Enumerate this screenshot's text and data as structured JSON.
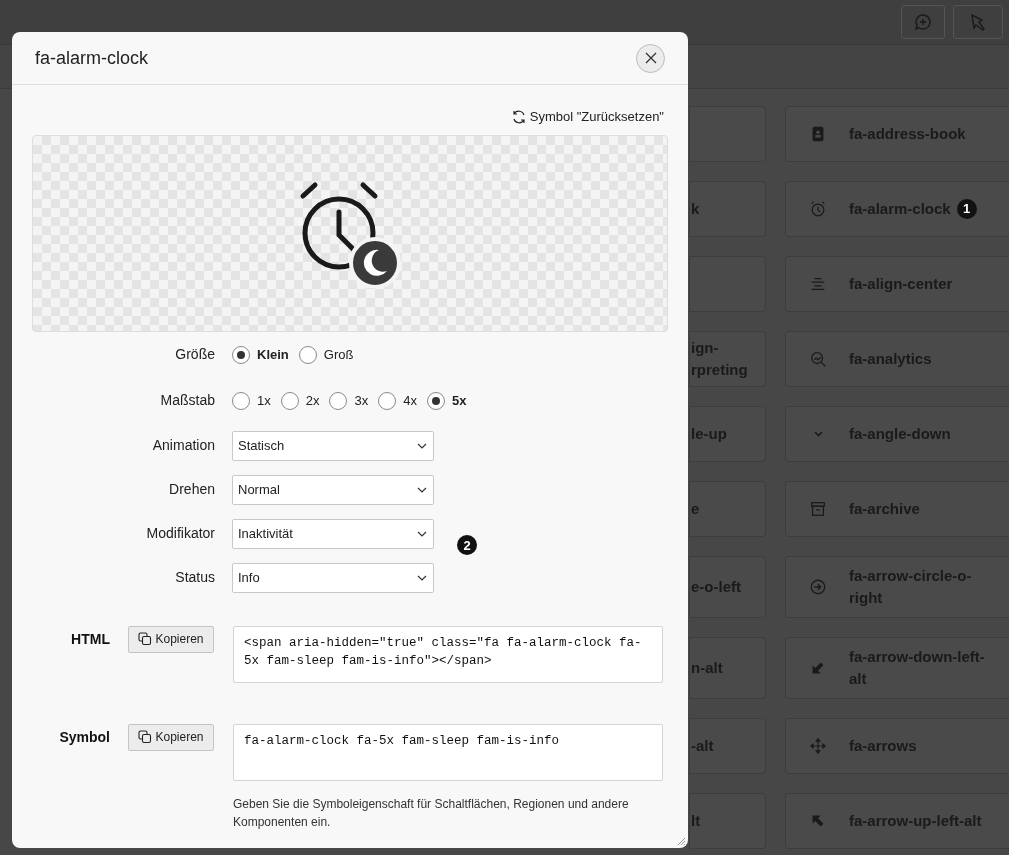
{
  "icon_grid": {
    "left_column": [
      {
        "kind": "covered"
      },
      {
        "kind": "text",
        "lines": [
          "k"
        ]
      },
      {
        "kind": "covered"
      },
      {
        "kind": "text",
        "lines": [
          "ign-",
          "rpreting"
        ]
      },
      {
        "kind": "text",
        "lines": [
          "le-up"
        ]
      },
      {
        "kind": "text",
        "lines": [
          "e"
        ]
      },
      {
        "kind": "text",
        "lines": [
          "e-o-left"
        ]
      },
      {
        "kind": "text",
        "lines": [
          "n-alt"
        ]
      },
      {
        "kind": "text",
        "lines": [
          "-alt"
        ]
      },
      {
        "kind": "text",
        "lines": [
          "lt"
        ]
      }
    ],
    "right_column": [
      {
        "kind": "address-book",
        "label": "fa-address-book"
      },
      {
        "kind": "alarm-clock",
        "label": "fa-alarm-clock",
        "callout": "1"
      },
      {
        "kind": "align-center",
        "label": "fa-align-center"
      },
      {
        "kind": "analytics",
        "label": "fa-analytics"
      },
      {
        "kind": "angle-down",
        "label": "fa-angle-down"
      },
      {
        "kind": "archive",
        "label": "fa-archive"
      },
      {
        "kind": "arrow-circle-right",
        "label": "fa-arrow-circle-o-right"
      },
      {
        "kind": "arrow-down-left",
        "label": "fa-arrow-down-left-alt"
      },
      {
        "kind": "arrows",
        "label": "fa-arrows"
      },
      {
        "kind": "arrow-up-left",
        "label": "fa-arrow-up-left-alt"
      }
    ]
  },
  "dialog": {
    "title": "fa-alarm-clock",
    "reset_link": "Symbol \"Zurücksetzen\"",
    "fields": [
      {
        "kind": "radio",
        "label": "Größe",
        "options": [
          {
            "label": "Klein",
            "selected": true
          },
          {
            "label": "Groß",
            "selected": false
          }
        ]
      },
      {
        "kind": "radio",
        "label": "Maßstab",
        "options": [
          {
            "label": "1x",
            "selected": false
          },
          {
            "label": "2x",
            "selected": false
          },
          {
            "label": "3x",
            "selected": false
          },
          {
            "label": "4x",
            "selected": false
          },
          {
            "label": "5x",
            "selected": true
          }
        ]
      },
      {
        "kind": "select",
        "label": "Animation",
        "value": "Statisch"
      },
      {
        "kind": "select",
        "label": "Drehen",
        "value": "Normal"
      },
      {
        "kind": "select",
        "label": "Modifikator",
        "value": "Inaktivität",
        "callout": "2"
      },
      {
        "kind": "select",
        "label": "Status",
        "value": "Info"
      }
    ],
    "outputs": [
      {
        "label": "HTML",
        "button": "Kopieren",
        "value": "<span aria-hidden=\"true\" class=\"fa fa-alarm-clock fa-5x fam-sleep fam-is-info\"></span>"
      },
      {
        "label": "Symbol",
        "button": "Kopieren",
        "value": "fa-alarm-clock fa-5x fam-sleep fam-is-info",
        "help": "Geben Sie die Symboleigenschaft für Schaltflächen, Regionen und andere Komponenten ein."
      }
    ]
  }
}
